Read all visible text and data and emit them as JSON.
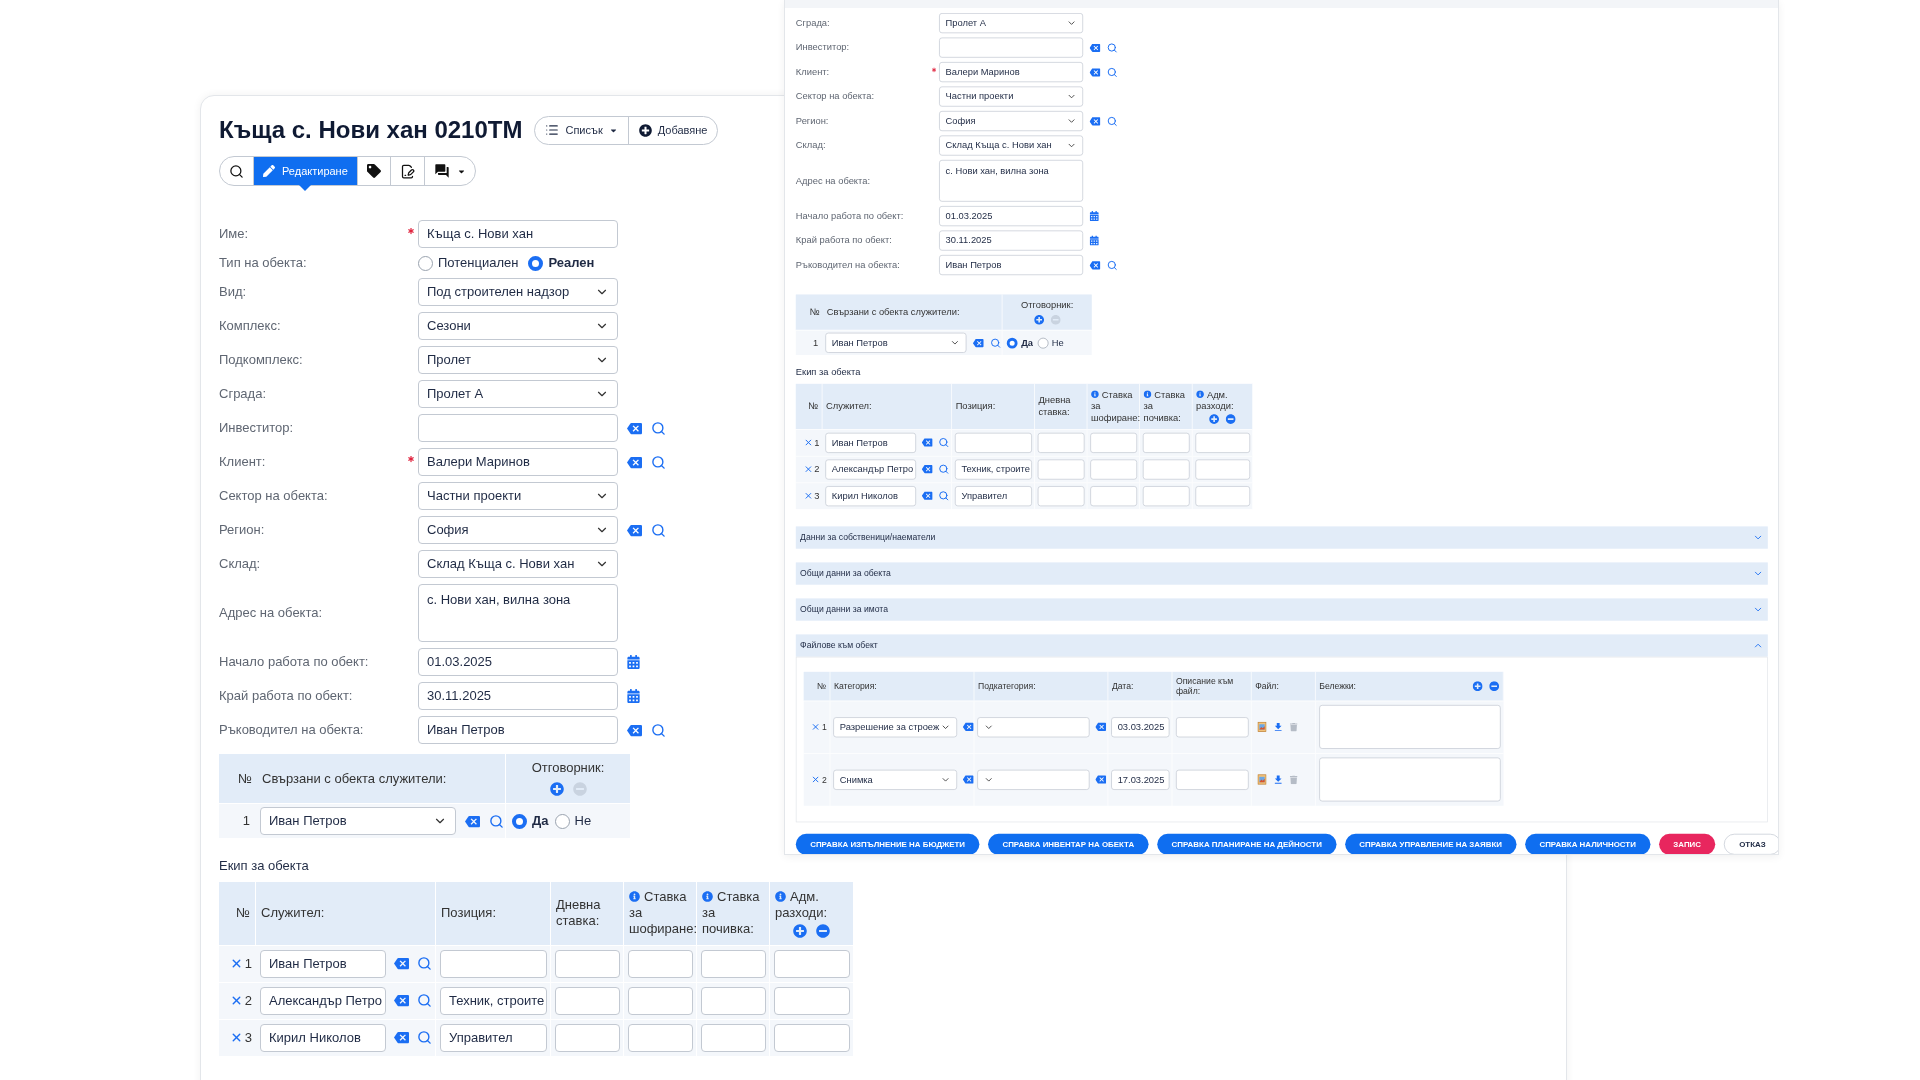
{
  "left_window": {
    "title": "Къща с. Нови хан 0210ТМ",
    "header_buttons": [
      {
        "label": "Списък",
        "kind": "dropdown"
      },
      {
        "label": "Добавяне",
        "kind": "add"
      }
    ],
    "toolbar": [
      {
        "kind": "search",
        "selected": false
      },
      {
        "kind": "edit",
        "label": "Редактиране",
        "selected": true
      },
      {
        "kind": "tag",
        "selected": false
      },
      {
        "kind": "sign",
        "selected": false
      },
      {
        "kind": "comments",
        "selected": false
      }
    ],
    "fields": [
      {
        "label": "Име:",
        "kind": "text",
        "required": true,
        "value": "Къща с. Нови хан"
      },
      {
        "label": "Тип на обекта:",
        "kind": "radio",
        "required": false,
        "options": [
          {
            "label": "Потенциален",
            "selected": false
          },
          {
            "label": "Реален",
            "selected": true
          }
        ]
      },
      {
        "label": "Вид:",
        "kind": "select",
        "required": false,
        "value": "Под строителен надзор"
      },
      {
        "label": "Комплекс:",
        "kind": "select",
        "required": false,
        "value": "Сезони"
      },
      {
        "label": "Подкомплекс:",
        "kind": "select",
        "required": false,
        "value": "Пролет"
      },
      {
        "label": "Сграда:",
        "kind": "select",
        "required": false,
        "value": "Пролет А"
      },
      {
        "label": "Инвеститор:",
        "kind": "lookup",
        "required": false
      },
      {
        "label": "Клиент:",
        "kind": "lookup",
        "required": true,
        "value": "Валери Маринов"
      },
      {
        "label": "Сектор на обекта:",
        "kind": "select",
        "required": false,
        "value": "Частни проекти"
      },
      {
        "label": "Регион:",
        "kind": "select_lookup",
        "required": false,
        "value": "София"
      },
      {
        "label": "Склад:",
        "kind": "select",
        "required": false,
        "value": "Склад Къща с. Нови хан"
      },
      {
        "label": "Адрес на обекта:",
        "kind": "textarea",
        "required": false,
        "value": "с. Нови хан, вилна зона"
      },
      {
        "label": "Начало работа по обект:",
        "kind": "date",
        "required": false,
        "value": "01.03.2025"
      },
      {
        "label": "Край работа по обект:",
        "kind": "date",
        "required": false,
        "value": "30.11.2025"
      },
      {
        "label": "Ръководител на обекта:",
        "kind": "lookup",
        "required": false,
        "value": "Иван Петров"
      }
    ],
    "related": {
      "columns": [
        "№",
        "Свързани с обекта служители:",
        "Отговорник:"
      ],
      "remove_enabled": false,
      "rows": [
        {
          "number": "1",
          "employee": "Иван Петров",
          "options": [
            {
              "label": "Да",
              "selected": true
            },
            {
              "label": "Не",
              "selected": false
            }
          ]
        }
      ]
    },
    "team": {
      "title": "Екип за обекта",
      "remove_enabled": true,
      "columns": [
        {
          "label": "№",
          "info": false
        },
        {
          "label": "Служител:",
          "info": false
        },
        {
          "label": "Позиция:",
          "info": false
        },
        {
          "label": "Дневна ставка:",
          "info": false
        },
        {
          "label": "Ставка за шофиране:",
          "info": true
        },
        {
          "label": "Ставка за почивка:",
          "info": true
        },
        {
          "label": "Адм. разходи:",
          "info": true
        }
      ],
      "rows": [
        {
          "number": "1",
          "employee": "Иван Петров"
        },
        {
          "number": "2",
          "employee": "Александър Петро",
          "position": "Техник, строите"
        },
        {
          "number": "3",
          "employee": "Кирил Николов",
          "position": "Управител"
        }
      ]
    }
  },
  "right_window": {
    "fields": [
      {
        "label": "Сграда:",
        "kind": "select",
        "required": false,
        "value": "Пролет А"
      },
      {
        "label": "Инвеститор:",
        "kind": "lookup",
        "required": false
      },
      {
        "label": "Клиент:",
        "kind": "lookup",
        "required": true,
        "value": "Валери Маринов"
      },
      {
        "label": "Сектор на обекта:",
        "kind": "select",
        "required": false,
        "value": "Частни проекти"
      },
      {
        "label": "Регион:",
        "kind": "select_lookup",
        "required": false,
        "value": "София"
      },
      {
        "label": "Склад:",
        "kind": "select",
        "required": false,
        "value": "Склад Къща с. Нови хан"
      },
      {
        "label": "Адрес на обекта:",
        "kind": "textarea",
        "required": false,
        "value": "с. Нови хан, вилна зона"
      },
      {
        "label": "Начало работа по обект:",
        "kind": "date",
        "required": false,
        "value": "01.03.2025"
      },
      {
        "label": "Край работа по обект:",
        "kind": "date",
        "required": false,
        "value": "30.11.2025"
      },
      {
        "label": "Ръководител на обекта:",
        "kind": "lookup",
        "required": false,
        "value": "Иван Петров"
      }
    ],
    "related": {
      "columns": [
        "№",
        "Свързани с обекта служители:",
        "Отговорник:"
      ],
      "remove_enabled": false,
      "rows": [
        {
          "number": "1",
          "employee": "Иван Петров",
          "options": [
            {
              "label": "Да",
              "selected": true
            },
            {
              "label": "Не",
              "selected": false
            }
          ]
        }
      ]
    },
    "team": {
      "title": "Екип за обекта",
      "remove_enabled": true,
      "columns": [
        {
          "label": "№",
          "info": false
        },
        {
          "label": "Служител:",
          "info": false
        },
        {
          "label": "Позиция:",
          "info": false
        },
        {
          "label": "Дневна ставка:",
          "info": false
        },
        {
          "label": "Ставка за шофиране:",
          "info": true
        },
        {
          "label": "Ставка за почивка:",
          "info": true
        },
        {
          "label": "Адм. разходи:",
          "info": true
        }
      ],
      "rows": [
        {
          "number": "1",
          "employee": "Иван Петров"
        },
        {
          "number": "2",
          "employee": "Александър Петро",
          "position": "Техник, строите"
        },
        {
          "number": "3",
          "employee": "Кирил Николов",
          "position": "Управител"
        }
      ]
    },
    "sections": [
      {
        "title": "Данни за собственици/наематели",
        "expanded": false
      },
      {
        "title": "Общи данни за обекта",
        "expanded": false
      },
      {
        "title": "Общи данни за имота",
        "expanded": false
      },
      {
        "title": "Файлове към обект",
        "expanded": true,
        "files": {
          "columns": [
            "№",
            "Категория:",
            "Подкатегория:",
            "Дата:",
            "Описание към файл:",
            "Файл:",
            "Бележки:"
          ],
          "remove_enabled": true,
          "rows": [
            {
              "number": "1",
              "category": "Разрешение за строеж",
              "date": "03.03.2025"
            },
            {
              "number": "2",
              "category": "Снимка",
              "date": "17.03.2025"
            }
          ]
        }
      }
    ],
    "buttons": [
      {
        "label": "СПРАВКА ИЗПЪЛНЕНИЕ НА БЮДЖЕТИ",
        "kind": "report"
      },
      {
        "label": "СПРАВКА ИНВЕНТАР НА ОБЕКТА",
        "kind": "report"
      },
      {
        "label": "СПРАВКА ПЛАНИРАНЕ НА ДЕЙНОСТИ",
        "kind": "report"
      },
      {
        "label": "СПРАВКА УПРАВЛЕНИЕ НА ЗАЯВКИ",
        "kind": "report"
      },
      {
        "label": "СПРАВКА НАЛИЧНОСТИ",
        "kind": "report"
      },
      {
        "label": "ЗАПИС",
        "kind": "save"
      },
      {
        "label": "ОТКАЗ",
        "kind": "cancel"
      }
    ]
  }
}
